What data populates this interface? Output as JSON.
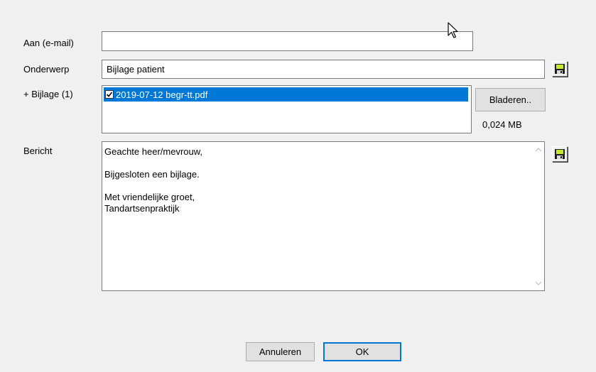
{
  "form": {
    "to_label": "Aan (e-mail)",
    "to_value": "",
    "subject_label": "Onderwerp",
    "subject_value": "Bijlage patient",
    "attachment_label": "+ Bijlage (1)",
    "attachments": [
      {
        "filename": "2019-07-12 begr-tt.pdf",
        "checked": true
      }
    ],
    "browse_label": "Bladeren..",
    "attachment_size": "0,024 MB",
    "message_label": "Bericht",
    "message_lines": [
      "Geachte heer/mevrouw,",
      "",
      "Bijgesloten een bijlage.",
      "",
      "Met vriendelijke groet,",
      "Tandartsenpraktijk"
    ]
  },
  "buttons": {
    "cancel_label": "Annuleren",
    "ok_label": "OK"
  },
  "icons": {
    "save_subject": "floppy-disk-icon",
    "save_message": "floppy-disk-icon",
    "cursor": "mouse-pointer-icon"
  },
  "colors": {
    "background": "#f0f0f0",
    "selection": "#0078d7",
    "default_button_border": "#0078d7",
    "floppy_body": "#1f1f1f",
    "floppy_label": "#c8e832"
  }
}
